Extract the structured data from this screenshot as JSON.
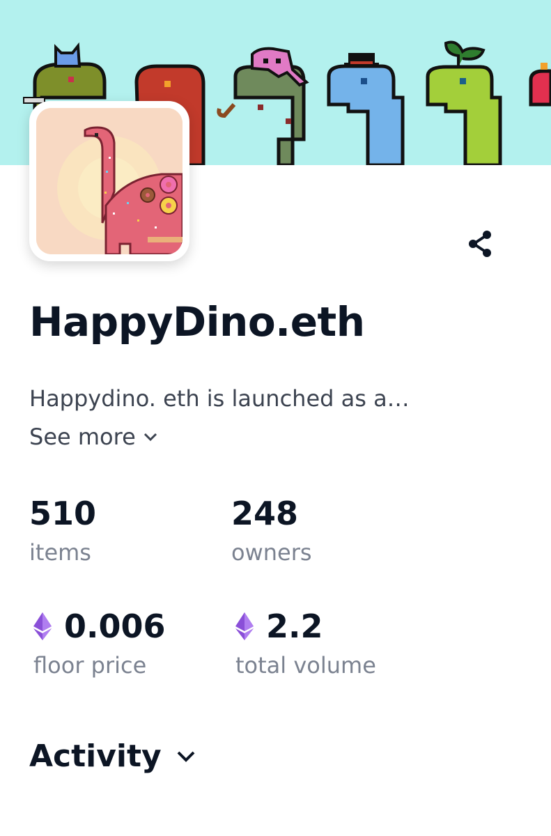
{
  "collection": {
    "name": "HappyDino.eth",
    "description": "Happydino. eth is launched as a…",
    "see_more_label": "See more"
  },
  "stats": {
    "items": {
      "value": "510",
      "label": "items"
    },
    "owners": {
      "value": "248",
      "label": "owners"
    },
    "floor_price": {
      "value": "0.006",
      "label": "floor price",
      "icon": "ethereum-icon"
    },
    "total_volume": {
      "value": "2.2",
      "label": "total volume",
      "icon": "ethereum-icon"
    }
  },
  "activity": {
    "label": "Activity"
  },
  "colors": {
    "banner_bg": "#b3f1ee",
    "avatar_bg": "#f8d9c3",
    "text_primary": "#0c1524",
    "text_secondary": "#3c4350",
    "text_muted": "#7b8290",
    "eth_purple": "#8a4fd8"
  },
  "icons": {
    "share": "share-icon",
    "see_more_chevron": "chevron-down-icon",
    "activity_chevron": "chevron-down-icon"
  }
}
